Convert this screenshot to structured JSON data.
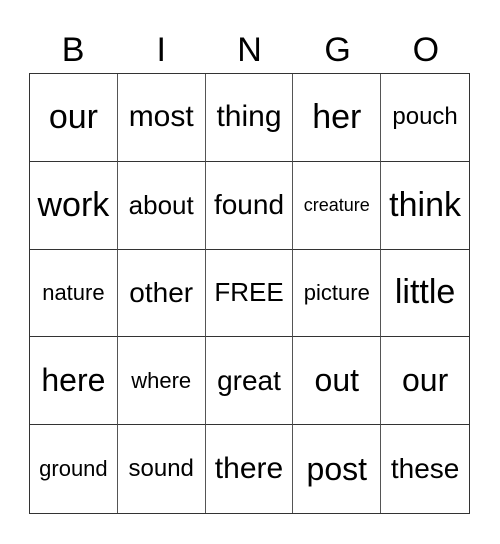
{
  "header": [
    "B",
    "I",
    "N",
    "G",
    "O"
  ],
  "rows": [
    [
      "our",
      "most",
      "thing",
      "her",
      "pouch"
    ],
    [
      "work",
      "about",
      "found",
      "creature",
      "think"
    ],
    [
      "nature",
      "other",
      "FREE",
      "picture",
      "little"
    ],
    [
      "here",
      "where",
      "great",
      "out",
      "our"
    ],
    [
      "ground",
      "sound",
      "there",
      "post",
      "these"
    ]
  ]
}
